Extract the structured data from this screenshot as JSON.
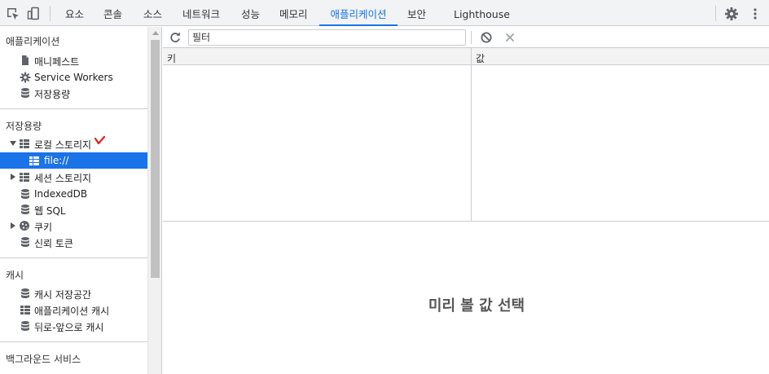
{
  "tabs": [
    {
      "label": "요소",
      "active": false
    },
    {
      "label": "콘솔",
      "active": false
    },
    {
      "label": "소스",
      "active": false
    },
    {
      "label": "네트워크",
      "active": false
    },
    {
      "label": "성능",
      "active": false
    },
    {
      "label": "메모리",
      "active": false
    },
    {
      "label": "애플리케이션",
      "active": true
    },
    {
      "label": "보안",
      "active": false
    },
    {
      "label": "Lighthouse",
      "active": false
    }
  ],
  "toolbar_icons": [
    "inspect-element-icon",
    "device-toolbar-icon",
    "settings-gear-icon",
    "more-options-icon"
  ],
  "sidebar": {
    "sections": [
      {
        "title": "애플리케이션",
        "items": [
          {
            "label": "매니페스트",
            "icon": "file-icon"
          },
          {
            "label": "Service Workers",
            "icon": "gear-icon"
          },
          {
            "label": "저장용량",
            "icon": "database-icon"
          }
        ]
      },
      {
        "title": "저장용량",
        "items": [
          {
            "label": "로컬 스토리지",
            "icon": "grid-icon",
            "expanded": true
          },
          {
            "label": "file://",
            "icon": "grid-icon",
            "selected": true
          },
          {
            "label": "세션 스토리지",
            "icon": "grid-icon",
            "expanded": false
          },
          {
            "label": "IndexedDB",
            "icon": "database-icon"
          },
          {
            "label": "웹 SQL",
            "icon": "database-icon"
          },
          {
            "label": "쿠키",
            "icon": "cookie-icon",
            "expanded": false
          },
          {
            "label": "신뢰 토큰",
            "icon": "database-icon"
          }
        ]
      },
      {
        "title": "캐시",
        "items": [
          {
            "label": "캐시 저장공간",
            "icon": "database-icon"
          },
          {
            "label": "애플리케이션 캐시",
            "icon": "grid-icon"
          },
          {
            "label": "뒤로-앞으로 캐시",
            "icon": "database-icon"
          }
        ]
      },
      {
        "title": "백그라운드 서비스",
        "items": []
      }
    ]
  },
  "main": {
    "filter_value": "필터",
    "columns": [
      "키",
      "값"
    ],
    "preview_message": "미리 볼 값 선택"
  },
  "colors": {
    "accent": "#1a73e8",
    "annotation": "#e0201b"
  }
}
